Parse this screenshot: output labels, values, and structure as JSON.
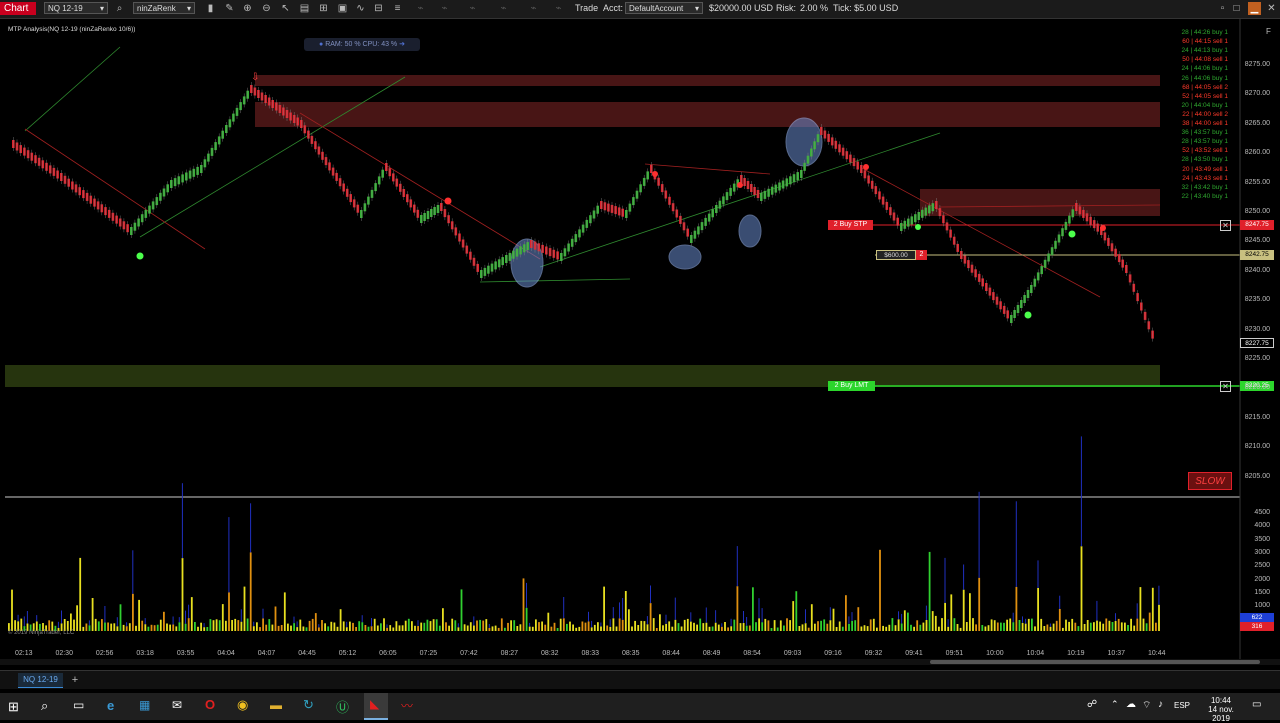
{
  "toolbar": {
    "chart_label": "Chart",
    "instrument": "NQ 12-19",
    "bar_type": "ninZaRenk",
    "trade_label": "Trade",
    "acct_label": "Acct:",
    "account": "DefaultAccount",
    "balance": "$20000.00 USD",
    "risk_label": "Risk:",
    "risk_value": "2.00 %",
    "tick_label": "Tick: $5.00 USD",
    "f_label": "F"
  },
  "chart": {
    "title": "MTP Analysis(NQ 12-19 (ninZaRenko 10/6))",
    "ram_cpu": "RAM: 50 %  CPU: 43 %",
    "copyright": "© 2019 NinjaTrader, LLC",
    "buy_stp_label": "2 Buy STP",
    "buy_lmt_label": "2 Buy LMT",
    "stop_amount": "$600.00",
    "stop_qty": "2",
    "slow_badge": "SLOW",
    "price_axis": [
      "8275.00",
      "8270.00",
      "8265.00",
      "8260.00",
      "8255.00",
      "8250.00",
      "8245.00",
      "8240.00",
      "8235.00",
      "8230.00",
      "8225.00",
      "8220.00",
      "8215.00",
      "8210.00",
      "8205.00"
    ],
    "price_tags": {
      "buy_stp": "8247.75",
      "mid": "8242.75",
      "last": "8227.75",
      "buy_lmt": "8220.25"
    },
    "time_axis": [
      "02:13",
      "02:30",
      "02:56",
      "03:18",
      "03:55",
      "04:04",
      "04:07",
      "04:45",
      "05:12",
      "06:05",
      "07:25",
      "07:42",
      "08:27",
      "08:32",
      "08:33",
      "08:35",
      "08:44",
      "08:49",
      "08:54",
      "09:03",
      "09:16",
      "09:32",
      "09:41",
      "09:51",
      "10:00",
      "10:04",
      "10:19",
      "10:37",
      "10:44"
    ],
    "volume_axis": [
      "4500",
      "4000",
      "3500",
      "3000",
      "2500",
      "2000",
      "1500",
      "1000",
      "500"
    ],
    "volume_tags": [
      "622",
      "316"
    ],
    "time_and_sales": [
      {
        "text": "28 | 44:26 buy 1",
        "side": "buy"
      },
      {
        "text": "60 | 44:15 sell 1",
        "side": "sell"
      },
      {
        "text": "24 | 44:13 buy 1",
        "side": "buy"
      },
      {
        "text": "50 | 44:08 sell 1",
        "side": "sell"
      },
      {
        "text": "24 | 44:06 buy 1",
        "side": "buy"
      },
      {
        "text": "26 | 44:06 buy 1",
        "side": "buy"
      },
      {
        "text": "68 | 44:05 sell 2",
        "side": "sell"
      },
      {
        "text": "52 | 44:05 sell 1",
        "side": "sell"
      },
      {
        "text": "20 | 44:04 buy 1",
        "side": "buy"
      },
      {
        "text": "22 | 44:00 sell 2",
        "side": "sell"
      },
      {
        "text": "38 | 44:00 sell 1",
        "side": "sell"
      },
      {
        "text": "36 | 43:57 buy 1",
        "side": "buy"
      },
      {
        "text": "28 | 43:57 buy 1",
        "side": "buy"
      },
      {
        "text": "52 | 43:52 sell 1",
        "side": "sell"
      },
      {
        "text": "28 | 43:50 buy 1",
        "side": "buy"
      },
      {
        "text": "20 | 43:49 sell 1",
        "side": "sell"
      },
      {
        "text": "24 | 43:43 sell 1",
        "side": "sell"
      },
      {
        "text": "32 | 43:42 buy 1",
        "side": "buy"
      },
      {
        "text": "22 | 43:40 buy 1",
        "side": "buy"
      }
    ]
  },
  "tabs": [
    {
      "label": "NQ 12-19"
    }
  ],
  "taskbar": {
    "lang": "ESP",
    "time": "10:44",
    "date": "14 nov. 2019"
  },
  "colors": {
    "bull": "#34b233",
    "bear": "#e0202a",
    "zone_red": "#5a1a1a",
    "zone_green": "#2a3a10",
    "accent": "#1e7fd6"
  }
}
